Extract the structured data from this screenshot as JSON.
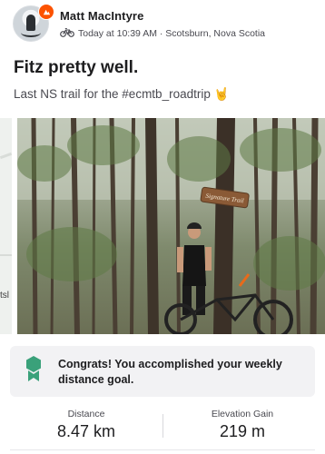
{
  "post": {
    "author": "Matt MacIntyre",
    "meta": "Today at 10:39 AM · Scotsburn, Nova Scotia",
    "activity_icon": "bike-icon",
    "title": "Fitz pretty well.",
    "description": "Last NS trail for the #ecmtb_roadtrip",
    "description_emoji": "🤘"
  },
  "map": {
    "label_fragment": "tsl"
  },
  "photo": {
    "sign_text": "Signature Trail"
  },
  "achievement": {
    "icon": "badge-icon",
    "text": "Congrats! You accomplished your weekly distance goal."
  },
  "stats": [
    {
      "label": "Distance",
      "value": "8.47 km"
    },
    {
      "label": "Elevation Gain",
      "value": "219 m"
    }
  ],
  "colors": {
    "brand": "#fc5200",
    "badge_green": "#3aa17a"
  }
}
